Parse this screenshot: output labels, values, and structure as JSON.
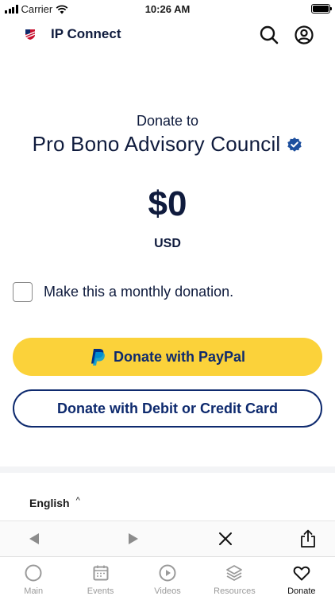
{
  "status_bar": {
    "carrier": "Carrier",
    "time": "10:26 AM",
    "battery_level": 1.0
  },
  "header": {
    "app_title": "IP Connect",
    "logo_icon": "flag-shield-icon",
    "search_icon": "search-icon",
    "account_icon": "user-circle-icon"
  },
  "donation": {
    "donate_to": "Donate to",
    "org_name": "Pro Bono Advisory Council",
    "amount": "$0",
    "currency": "USD",
    "monthly_label": "Make this a monthly donation.",
    "monthly_checked": false,
    "paypal_label": "Donate with PayPal",
    "card_label": "Donate with Debit or Credit Card"
  },
  "footer": {
    "language": "English"
  },
  "tabs": [
    {
      "label": "Main",
      "icon": "circle-icon",
      "active": false
    },
    {
      "label": "Events",
      "icon": "calendar-icon",
      "active": false
    },
    {
      "label": "Videos",
      "icon": "play-circle-icon",
      "active": false
    },
    {
      "label": "Resources",
      "icon": "layers-icon",
      "active": false
    },
    {
      "label": "Donate",
      "icon": "heart-icon",
      "active": true
    }
  ],
  "colors": {
    "navy": "#0f1b3d",
    "button_navy": "#0e2a6e",
    "paypal_yellow": "#fbd23a",
    "verified_blue": "#1d4f9e",
    "inactive_tab": "#9a9a9a"
  }
}
